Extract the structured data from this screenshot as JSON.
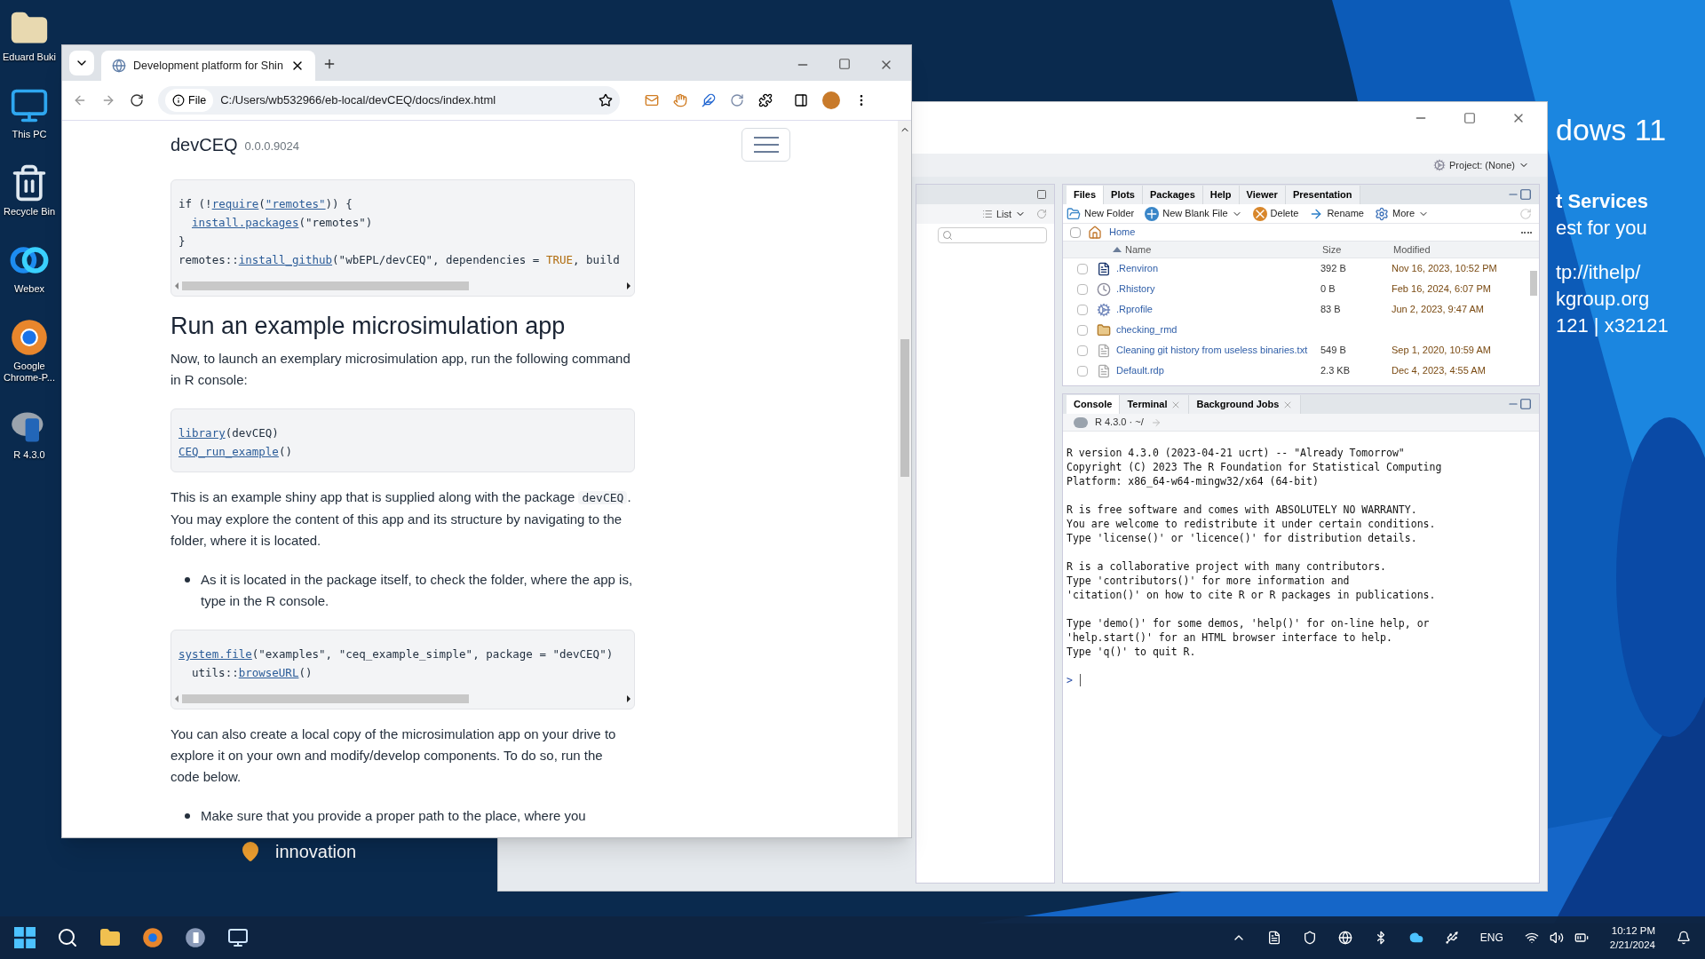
{
  "desktop_icons": [
    {
      "label": "Eduard Buki",
      "kind": "folder"
    },
    {
      "label": "This PC",
      "kind": "monitor"
    },
    {
      "label": "Recycle Bin",
      "kind": "bin"
    },
    {
      "label": "Webex",
      "kind": "webex"
    },
    {
      "label": "Google Chrome-P...",
      "kind": "chrome"
    },
    {
      "label": "R 4.3.0",
      "kind": "r"
    }
  ],
  "wallpaper_text": [
    "dows 11",
    "t Services",
    "est for you",
    "tp://ithelp/",
    "kgroup.org",
    "121 | x32121"
  ],
  "wallpaper_caption": "innovation",
  "browser": {
    "tab_title": "Development platform for Shin",
    "address_prefix": "File",
    "url": "C:/Users/wb532966/eb-local/devCEQ/docs/index.html",
    "site_title": "devCEQ",
    "version": "0.0.0.9024",
    "content": [
      {
        "kind": "code",
        "scroll": true,
        "lines": [
          {
            "indent": false,
            "parts": [
              {
                "text": "if (!",
                "kind": "plain"
              },
              {
                "text": "require",
                "kind": "link"
              },
              {
                "text": "(",
                "kind": "plain"
              },
              {
                "text": "\"remotes\"",
                "kind": "link"
              },
              {
                "text": ")) {",
                "kind": "plain"
              }
            ]
          },
          {
            "indent": true,
            "parts": [
              {
                "text": "install.packages",
                "kind": "link"
              },
              {
                "text": "(\"remotes\")",
                "kind": "plain"
              }
            ]
          },
          {
            "indent": false,
            "parts": [
              {
                "text": "}",
                "kind": "plain"
              }
            ]
          },
          {
            "indent": false,
            "parts": [
              {
                "text": "remotes::",
                "kind": "plain"
              },
              {
                "text": "install_github",
                "kind": "link"
              },
              {
                "text": "(\"wbEPL/devCEQ\", dependencies = ",
                "kind": "plain"
              },
              {
                "text": "TRUE",
                "kind": "constant"
              },
              {
                "text": ", build",
                "kind": "plain"
              }
            ]
          }
        ]
      },
      {
        "kind": "heading",
        "text": "Run an example microsimulation app"
      },
      {
        "kind": "paragraph",
        "parts": [
          {
            "text": "Now, to launch an exemplary microsimulation app, run the following command in R console:",
            "kind": "text"
          }
        ]
      },
      {
        "kind": "code",
        "scroll": false,
        "lines": [
          {
            "indent": false,
            "parts": [
              {
                "text": "library",
                "kind": "link"
              },
              {
                "text": "(devCEQ)",
                "kind": "plain"
              }
            ]
          },
          {
            "indent": false,
            "parts": [
              {
                "text": "CEQ_run_example",
                "kind": "link"
              },
              {
                "text": "()",
                "kind": "plain"
              }
            ]
          }
        ]
      },
      {
        "kind": "paragraph",
        "parts": [
          {
            "text": "This is an example shiny app that is supplied along with the package ",
            "kind": "text"
          },
          {
            "text": "devCEQ",
            "kind": "code"
          },
          {
            "text": ". You may explore the content of this app and its structure by navigating to the folder, where it is located.",
            "kind": "text"
          }
        ]
      },
      {
        "kind": "bullet",
        "text": "As it is located in the package itself, to check the folder, where the app is, type in the R console."
      },
      {
        "kind": "code",
        "scroll": true,
        "lines": [
          {
            "indent": false,
            "parts": [
              {
                "text": "system.file",
                "kind": "link"
              },
              {
                "text": "(\"examples\", \"ceq_example_simple\", package = \"devCEQ\")",
                "kind": "plain"
              }
            ]
          },
          {
            "indent": true,
            "parts": [
              {
                "text": "utils::",
                "kind": "plain"
              },
              {
                "text": "browseURL",
                "kind": "link"
              },
              {
                "text": "()",
                "kind": "plain"
              }
            ]
          }
        ]
      },
      {
        "kind": "paragraph",
        "parts": [
          {
            "text": "You can also create a local copy of the microsimulation app on your drive to explore it on your own and modify/develop components. To do so, run the code below.",
            "kind": "text"
          }
        ]
      },
      {
        "kind": "bullet",
        "text": "Make sure that you provide a proper path to the place, where you"
      }
    ]
  },
  "rstudio": {
    "project": "Project: (None)",
    "left_pane": {
      "view": "List"
    },
    "files_tabs": [
      {
        "label": "Files",
        "selected": true
      },
      {
        "label": "Plots",
        "selected": false
      },
      {
        "label": "Packages",
        "selected": false
      },
      {
        "label": "Help",
        "selected": false
      },
      {
        "label": "Viewer",
        "selected": false
      },
      {
        "label": "Presentation",
        "selected": false
      }
    ],
    "files_toolbar": [
      {
        "label": "New Folder",
        "kind": "folder",
        "menu": false
      },
      {
        "label": "New Blank File",
        "kind": "add",
        "menu": true
      },
      {
        "label": "Delete",
        "kind": "delete",
        "menu": false
      },
      {
        "label": "Rename",
        "kind": "rename",
        "menu": false
      },
      {
        "label": "More",
        "kind": "gear",
        "menu": true
      }
    ],
    "all_checked": false,
    "breadcrumb": "Home",
    "columns": [
      "Name",
      "Size",
      "Modified"
    ],
    "files": [
      {
        "name": ".Renviron",
        "size": "392 B",
        "modified": "Nov 16, 2023, 10:52 PM",
        "kind": "env",
        "checked": false
      },
      {
        "name": ".Rhistory",
        "size": "0 B",
        "modified": "Feb 16, 2024, 6:07 PM",
        "kind": "history",
        "checked": false
      },
      {
        "name": ".Rprofile",
        "size": "83 B",
        "modified": "Jun 2, 2023, 9:47 AM",
        "kind": "settings",
        "checked": false
      },
      {
        "name": "checking_rmd",
        "kind": "folder",
        "checked": false
      },
      {
        "name": "Cleaning git history from useless binaries.txt",
        "size": "549 B",
        "modified": "Sep 1, 2020, 10:59 AM",
        "kind": "file",
        "checked": false
      },
      {
        "name": "Default.rdp",
        "size": "2.3 KB",
        "modified": "Dec 4, 2023, 4:55 AM",
        "kind": "file",
        "checked": false
      }
    ],
    "console_tabs": [
      {
        "label": "Console",
        "selected": true,
        "closable": false
      },
      {
        "label": "Terminal",
        "selected": false,
        "closable": true
      },
      {
        "label": "Background Jobs",
        "selected": false,
        "closable": true
      }
    ],
    "console_status": "R 4.3.0 · ~/",
    "console_blocks": [
      [
        "R version 4.3.0 (2023-04-21 ucrt) -- \"Already Tomorrow\"",
        "Copyright (C) 2023 The R Foundation for Statistical Computing",
        "Platform: x86_64-w64-mingw32/x64 (64-bit)"
      ],
      [
        "R is free software and comes with ABSOLUTELY NO WARRANTY.",
        "You are welcome to redistribute it under certain conditions.",
        "Type 'license()' or 'licence()' for distribution details."
      ],
      [
        "R is a collaborative project with many contributors.",
        "Type 'contributors()' for more information and",
        "'citation()' on how to cite R or R packages in publications."
      ],
      [
        "Type 'demo()' for some demos, 'help()' for on-line help, or",
        "'help.start()' for an HTML browser interface to help.",
        "Type 'q()' to quit R."
      ]
    ],
    "prompt": ">"
  },
  "taskbar": {
    "language": "ENG",
    "time": "10:12 PM",
    "date": "2/21/2024"
  }
}
